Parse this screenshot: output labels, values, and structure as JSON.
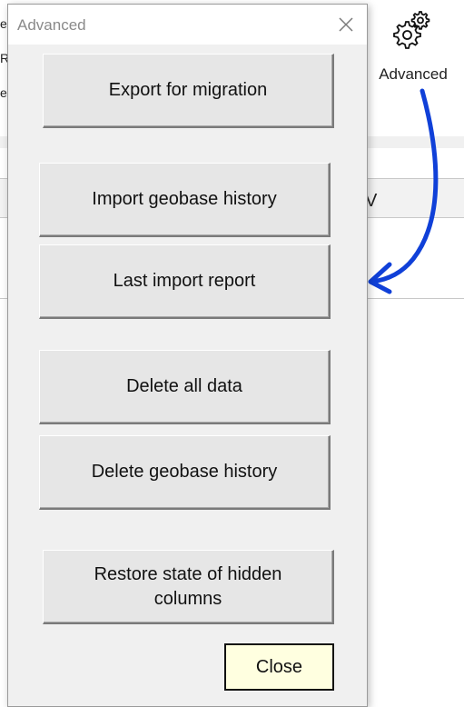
{
  "background": {
    "ribbon_left_fragments": [
      "e",
      "R",
      "e"
    ],
    "advanced_label": "Advanced",
    "column_header_fragment": "V",
    "arrow_color": "#1040d8"
  },
  "dialog": {
    "title": "Advanced",
    "buttons": {
      "export": "Export for migration",
      "import_history": "Import geobase history",
      "last_report": "Last import report",
      "delete_all": "Delete all data",
      "delete_history": "Delete geobase history",
      "restore_line1": "Restore state of hidden",
      "restore_line2": "columns",
      "close": "Close"
    },
    "close_button_color": "#ffffe0"
  }
}
